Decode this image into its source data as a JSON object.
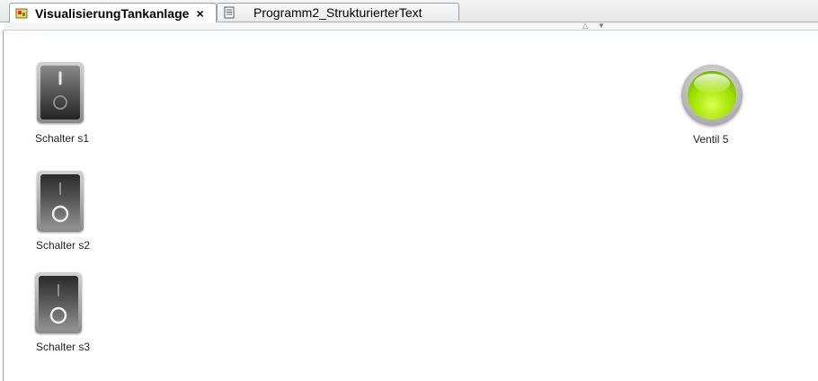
{
  "tabs": [
    {
      "label": "VisualisierungTankanlage",
      "icon": "visualization-icon",
      "active": true,
      "close_symbol": "×"
    },
    {
      "label": "Programm2_StrukturierterText",
      "icon": "document-icon",
      "active": false
    }
  ],
  "subbar": {
    "up_arrow": "△",
    "down_arrow": "▼"
  },
  "switches": [
    {
      "label": "Schalter s1",
      "state": "on"
    },
    {
      "label": "Schalter s2",
      "state": "off"
    },
    {
      "label": "Schalter s3",
      "state": "off"
    }
  ],
  "lamp": {
    "label": "Ventil 5",
    "state": "on",
    "color": "#9fe000"
  }
}
